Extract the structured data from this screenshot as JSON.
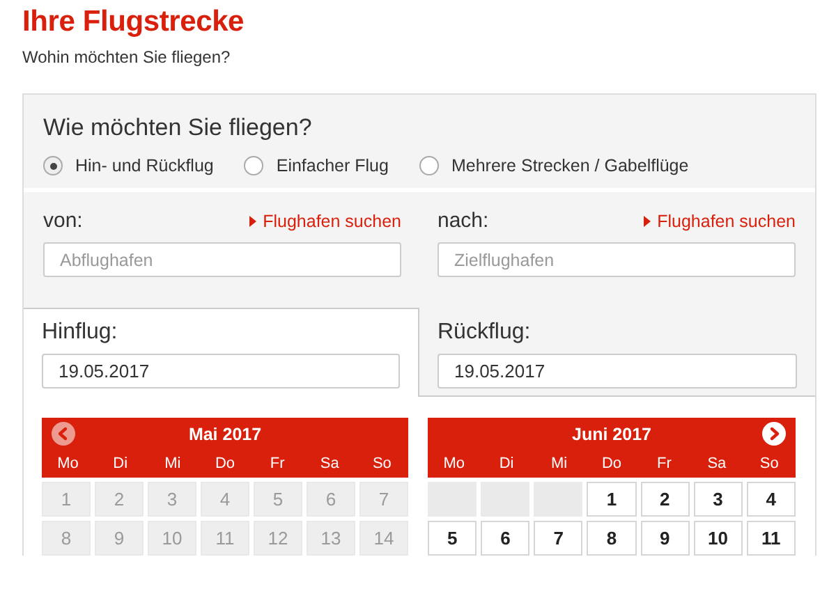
{
  "page": {
    "title": "Ihre Flugstrecke",
    "subtitle": "Wohin möchten Sie fliegen?"
  },
  "trip_type": {
    "heading": "Wie möchten Sie fliegen?",
    "options": [
      {
        "label": "Hin- und Rückflug",
        "selected": true
      },
      {
        "label": "Einfacher Flug",
        "selected": false
      },
      {
        "label": "Mehrere Strecken / Gabelflüge",
        "selected": false
      }
    ]
  },
  "airports": [
    {
      "label": "von:",
      "link": "Flughafen suchen",
      "placeholder": "Abflughafen"
    },
    {
      "label": "nach:",
      "link": "Flughafen suchen",
      "placeholder": "Zielflughafen"
    }
  ],
  "dates": [
    {
      "label": "Hinflug:",
      "value": "19.05.2017",
      "selected": true
    },
    {
      "label": "Rückflug:",
      "value": "19.05.2017",
      "selected": false
    }
  ],
  "calendars": [
    {
      "title": "Mai 2017",
      "nav": {
        "kind": "prev",
        "disabled": true
      },
      "weekdays": [
        "Mo",
        "Di",
        "Mi",
        "Do",
        "Fr",
        "Sa",
        "So"
      ],
      "weeks": [
        [
          {
            "kind": "day",
            "day": "1",
            "disabled": true
          },
          {
            "kind": "day",
            "day": "2",
            "disabled": true
          },
          {
            "kind": "day",
            "day": "3",
            "disabled": true
          },
          {
            "kind": "day",
            "day": "4",
            "disabled": true
          },
          {
            "kind": "day",
            "day": "5",
            "disabled": true
          },
          {
            "kind": "day",
            "day": "6",
            "disabled": true
          },
          {
            "kind": "day",
            "day": "7",
            "disabled": true
          }
        ],
        [
          {
            "kind": "day",
            "day": "8",
            "disabled": true
          },
          {
            "kind": "day",
            "day": "9",
            "disabled": true
          },
          {
            "kind": "day",
            "day": "10",
            "disabled": true
          },
          {
            "kind": "day",
            "day": "11",
            "disabled": true
          },
          {
            "kind": "day",
            "day": "12",
            "disabled": true
          },
          {
            "kind": "day",
            "day": "13",
            "disabled": true
          },
          {
            "kind": "day",
            "day": "14",
            "disabled": true
          }
        ]
      ]
    },
    {
      "title": "Juni 2017",
      "nav": {
        "kind": "next",
        "disabled": false
      },
      "weekdays": [
        "Mo",
        "Di",
        "Mi",
        "Do",
        "Fr",
        "Sa",
        "So"
      ],
      "weeks": [
        [
          {
            "kind": "blank"
          },
          {
            "kind": "blank"
          },
          {
            "kind": "blank"
          },
          {
            "kind": "day",
            "day": "1",
            "disabled": false
          },
          {
            "kind": "day",
            "day": "2",
            "disabled": false
          },
          {
            "kind": "day",
            "day": "3",
            "disabled": false
          },
          {
            "kind": "day",
            "day": "4",
            "disabled": false
          }
        ],
        [
          {
            "kind": "day",
            "day": "5",
            "disabled": false
          },
          {
            "kind": "day",
            "day": "6",
            "disabled": false
          },
          {
            "kind": "day",
            "day": "7",
            "disabled": false
          },
          {
            "kind": "day",
            "day": "8",
            "disabled": false
          },
          {
            "kind": "day",
            "day": "9",
            "disabled": false
          },
          {
            "kind": "day",
            "day": "10",
            "disabled": false
          },
          {
            "kind": "day",
            "day": "11",
            "disabled": false
          }
        ]
      ]
    }
  ]
}
